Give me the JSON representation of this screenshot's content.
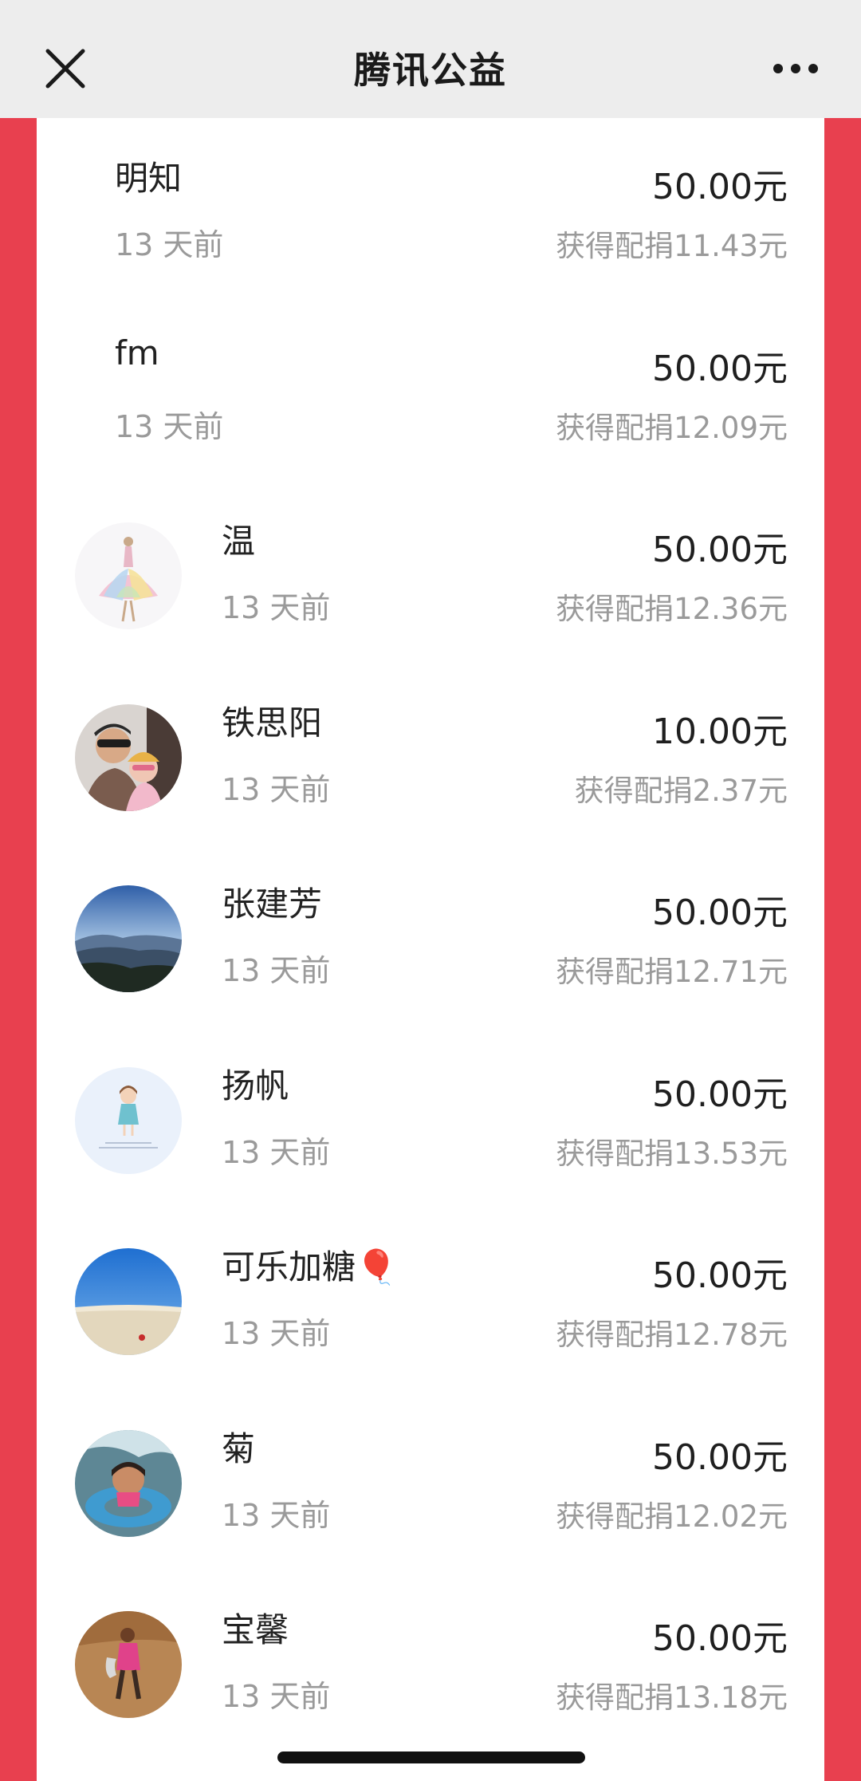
{
  "nav": {
    "title": "腾讯公益",
    "close_icon": "close-icon",
    "more_icon": "more-icon"
  },
  "colors": {
    "background_red": "#e8404f",
    "nav_bg": "#ededed",
    "panel_bg": "#ffffff",
    "text_primary": "#222222",
    "text_secondary": "#9a9a9a"
  },
  "donations": [
    {
      "name": "明知",
      "time": "13 天前",
      "amount": "50.00元",
      "match": "获得配捐11.43元",
      "avatar": "none"
    },
    {
      "name": "fm",
      "time": "13 天前",
      "amount": "50.00元",
      "match": "获得配捐12.09元",
      "avatar": "none"
    },
    {
      "name": "温",
      "time": "13 天前",
      "amount": "50.00元",
      "match": "获得配捐12.36元",
      "avatar": "ballerina-dress-illustration"
    },
    {
      "name": "铁思阳",
      "time": "13 天前",
      "amount": "10.00元",
      "match": "获得配捐2.37元",
      "avatar": "man-and-child-photo"
    },
    {
      "name": "张建芳",
      "time": "13 天前",
      "amount": "50.00元",
      "match": "获得配捐12.71元",
      "avatar": "mountain-landscape-photo"
    },
    {
      "name": "扬帆",
      "time": "13 天前",
      "amount": "50.00元",
      "match": "获得配捐13.53元",
      "avatar": "cartoon-girl-illustration"
    },
    {
      "name": "可乐加糖🎈",
      "time": "13 天前",
      "amount": "50.00元",
      "match": "获得配捐12.78元",
      "avatar": "desert-sky-photo"
    },
    {
      "name": "菊",
      "time": "13 天前",
      "amount": "50.00元",
      "match": "获得配捐12.02元",
      "avatar": "child-in-swim-ring-photo"
    },
    {
      "name": "宝馨",
      "time": "13 天前",
      "amount": "50.00元",
      "match": "获得配捐13.18元",
      "avatar": "girl-outdoors-photo"
    }
  ]
}
